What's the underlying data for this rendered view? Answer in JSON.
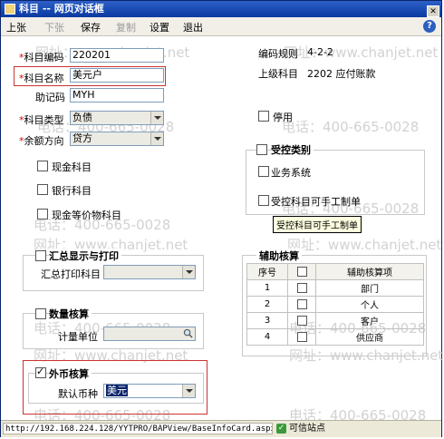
{
  "window": {
    "title": "科目 -- 网页对话框"
  },
  "toolbar": {
    "items": [
      {
        "label": "上张",
        "enabled": true
      },
      {
        "label": "下张",
        "enabled": false
      },
      {
        "label": "保存",
        "enabled": true
      },
      {
        "label": "复制",
        "enabled": false
      },
      {
        "label": "设置",
        "enabled": true
      },
      {
        "label": "退出",
        "enabled": true
      }
    ],
    "help_icon": "question-circle-icon"
  },
  "form": {
    "account_code_label": "科目编码",
    "account_code_value": "220201",
    "account_name_label": "科目名称",
    "account_name_value": "美元户",
    "mnemonic_label": "助记码",
    "mnemonic_value": "MYH",
    "account_type_label": "科目类型",
    "account_type_value": "负债",
    "balance_direction_label": "余额方向",
    "balance_direction_value": "贷方",
    "cash_label": "现金科目",
    "bank_label": "银行科目",
    "cash_equiv_label": "现金等价物科目",
    "code_rule_label": "编码规则",
    "code_rule_value": "4-2-2",
    "parent_label": "上级科目",
    "parent_value": "2202 应付账款",
    "disabled_label": "停用"
  },
  "controlled": {
    "title": "受控类别",
    "business_label": "业务系统",
    "manual_label": "受控科目可手工制单",
    "tooltip": "受控科目可手工制单"
  },
  "summary": {
    "title": "汇总显示与打印",
    "print_label": "汇总打印科目"
  },
  "quantity": {
    "title": "数量核算",
    "unit_label": "计量单位"
  },
  "currency": {
    "title": "外币核算",
    "checked": true,
    "default_label": "默认币种",
    "default_value": "美元"
  },
  "aux": {
    "title": "辅助核算",
    "columns": [
      "序号",
      "",
      "辅助核算项"
    ],
    "rows": [
      {
        "no": "1",
        "name": "部门"
      },
      {
        "no": "2",
        "name": "个人"
      },
      {
        "no": "3",
        "name": "客户"
      },
      {
        "no": "4",
        "name": "供应商"
      }
    ]
  },
  "statusbar": {
    "url": "http://192.168.224.128/YYTPRO/BAPView/BaseInfoCard.aspx",
    "zone": "可信站点"
  },
  "watermarks": {
    "phone": "电话：400-665-0028",
    "site": "网址：www.chanjet.net"
  },
  "colors": {
    "title_bar": "#0a3aa0",
    "required_mark": "#dd0000",
    "highlight_box": "#cc3333",
    "selection": "#0a246a"
  }
}
